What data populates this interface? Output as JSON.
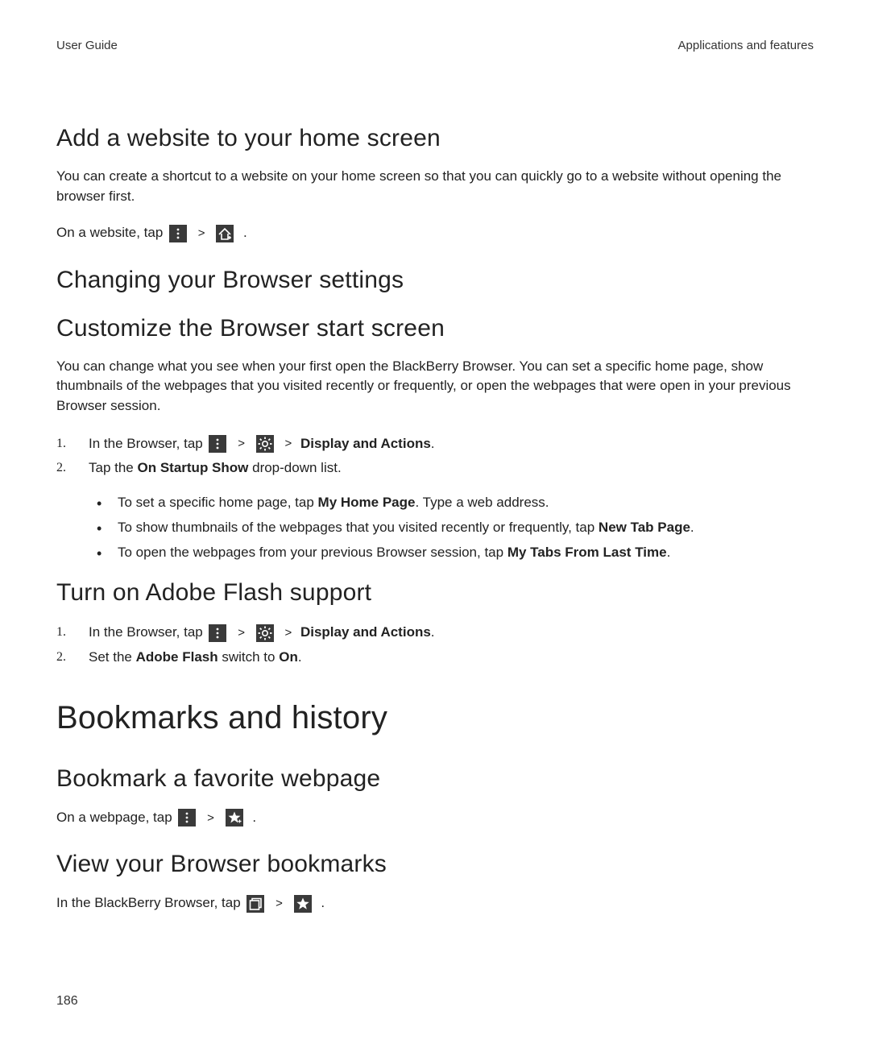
{
  "header": {
    "left": "User Guide",
    "right": "Applications and features"
  },
  "page_number": "186",
  "s1": {
    "title": "Add a website to your home screen",
    "body": "You can create a shortcut to a website on your home screen so that you can quickly go to a website without opening the browser first.",
    "instr_prefix": "On a website, tap "
  },
  "s2": {
    "title": "Changing your Browser settings"
  },
  "s3": {
    "title": "Customize the Browser start screen",
    "body": "You can change what you see when your first open the BlackBerry Browser. You can set a specific home page, show thumbnails of the webpages that you visited recently or frequently, or open the webpages that were open in your previous Browser session.",
    "step1_prefix": "In the Browser, tap ",
    "step1_bold": "Display and Actions",
    "step2_a": "Tap the ",
    "step2_b": "On Startup Show",
    "step2_c": " drop-down list.",
    "b1_a": "To set a specific home page, tap ",
    "b1_b": "My Home Page",
    "b1_c": ". Type a web address.",
    "b2_a": "To show thumbnails of the webpages that you visited recently or frequently, tap ",
    "b2_b": "New Tab Page",
    "b2_c": ".",
    "b3_a": "To open the webpages from your previous Browser session, tap ",
    "b3_b": "My Tabs From Last Time",
    "b3_c": "."
  },
  "s4": {
    "title": "Turn on Adobe Flash support",
    "step1_prefix": "In the Browser, tap ",
    "step1_bold": "Display and Actions",
    "step2_a": "Set the ",
    "step2_b": "Adobe Flash",
    "step2_c": " switch to ",
    "step2_d": "On",
    "step2_e": "."
  },
  "s5": {
    "title": "Bookmarks and history"
  },
  "s6": {
    "title": "Bookmark a favorite webpage",
    "instr_prefix": "On a webpage, tap "
  },
  "s7": {
    "title": "View your Browser bookmarks",
    "instr_prefix": "In the BlackBerry Browser, tap "
  },
  "nums": {
    "one": "1.",
    "two": "2."
  }
}
